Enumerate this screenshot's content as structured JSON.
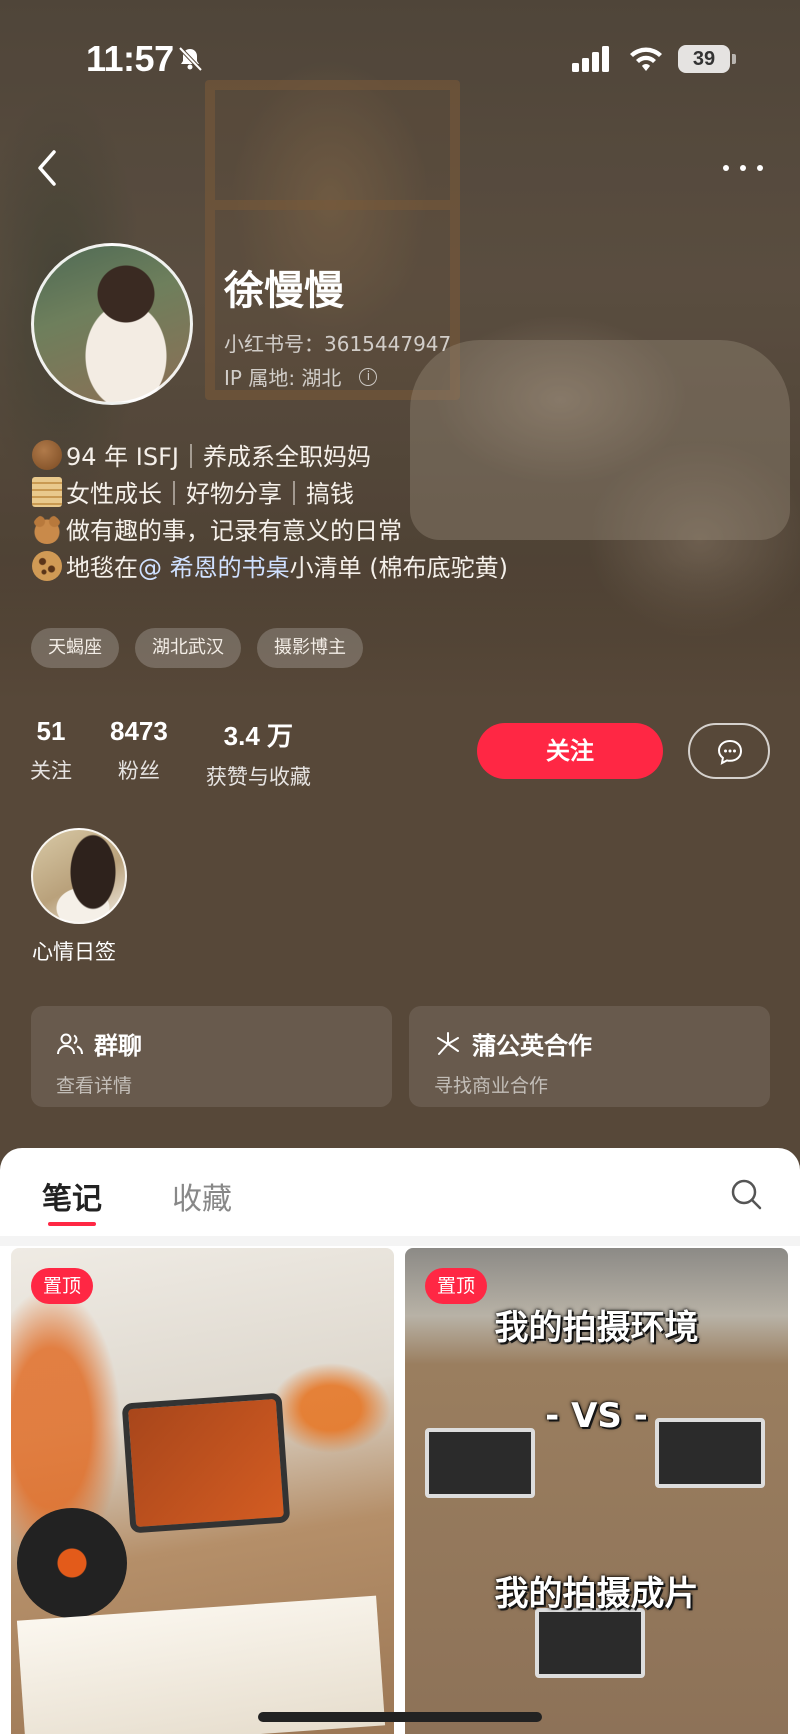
{
  "status_bar": {
    "time": "11:57",
    "battery": "39"
  },
  "profile": {
    "name": "徐慢慢",
    "xhs_id": "小红书号：3615447947",
    "ip_location": "IP 属地: 湖北"
  },
  "bio": [
    {
      "emoji": "brown-circle",
      "text": "94 年 ISFJ｜养成系全职妈妈"
    },
    {
      "emoji": "scroll",
      "text": "女性成长｜好物分享｜搞钱"
    },
    {
      "emoji": "teddy-bear",
      "text": "做有趣的事，记录有意义的日常"
    },
    {
      "emoji": "cookie",
      "text_before": "地毯在 ",
      "mention": "@ 希恩的书桌",
      "text_after": " 小清单 (棉布底驼黄)"
    }
  ],
  "tags": [
    "天蝎座",
    "湖北武汉",
    "摄影博主"
  ],
  "stats": [
    {
      "value": "51",
      "label": "关注"
    },
    {
      "value": "8473",
      "label": "粉丝"
    },
    {
      "value": "3.4 万",
      "label": "获赞与收藏"
    }
  ],
  "actions": {
    "follow": "关注"
  },
  "highlight": {
    "label": "心情日签"
  },
  "cards": [
    {
      "icon": "group-icon",
      "title": "群聊",
      "subtitle": "查看详情"
    },
    {
      "icon": "dandelion-icon",
      "title": "蒲公英合作",
      "subtitle": "寻找商业合作"
    }
  ],
  "tabs": [
    {
      "label": "笔记",
      "active": true
    },
    {
      "label": "收藏",
      "active": false
    }
  ],
  "posts": [
    {
      "badge": "置顶"
    },
    {
      "badge": "置顶",
      "text_top": "我的拍摄环境",
      "text_mid": "- VS -",
      "text_bottom": "我的拍摄成片"
    }
  ],
  "colors": {
    "accent": "#ff2744",
    "header_bg": "#574839"
  }
}
